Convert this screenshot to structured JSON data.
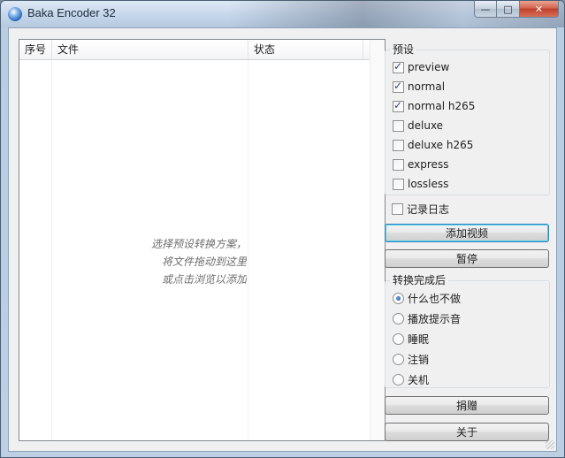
{
  "window": {
    "title": "Baka Encoder 32",
    "buttons": {
      "minimize": "—",
      "maximize": "□",
      "close": "✕"
    }
  },
  "file_list": {
    "columns": [
      "序号",
      "文件",
      "状态"
    ],
    "empty_hint": [
      "选择预设转换方案，",
      "将文件拖动到这里",
      "或点击浏览以添加"
    ]
  },
  "presets": {
    "label": "预设",
    "items": [
      {
        "label": "preview",
        "checked": true
      },
      {
        "label": "normal",
        "checked": true
      },
      {
        "label": "normal h265",
        "checked": true
      },
      {
        "label": "deluxe",
        "checked": false
      },
      {
        "label": "deluxe h265",
        "checked": false
      },
      {
        "label": "express",
        "checked": false
      },
      {
        "label": "lossless",
        "checked": false
      }
    ]
  },
  "log_option": {
    "label": "记录日志",
    "checked": false
  },
  "actions": {
    "add_video": "添加视频",
    "pause": "暂停",
    "donate": "捐赠",
    "about": "关于"
  },
  "after_conversion": {
    "label": "转换完成后",
    "options": [
      {
        "label": "什么也不做",
        "selected": true
      },
      {
        "label": "播放提示音",
        "selected": false
      },
      {
        "label": "睡眠",
        "selected": false
      },
      {
        "label": "注销",
        "selected": false
      },
      {
        "label": "关机",
        "selected": false
      }
    ]
  }
}
